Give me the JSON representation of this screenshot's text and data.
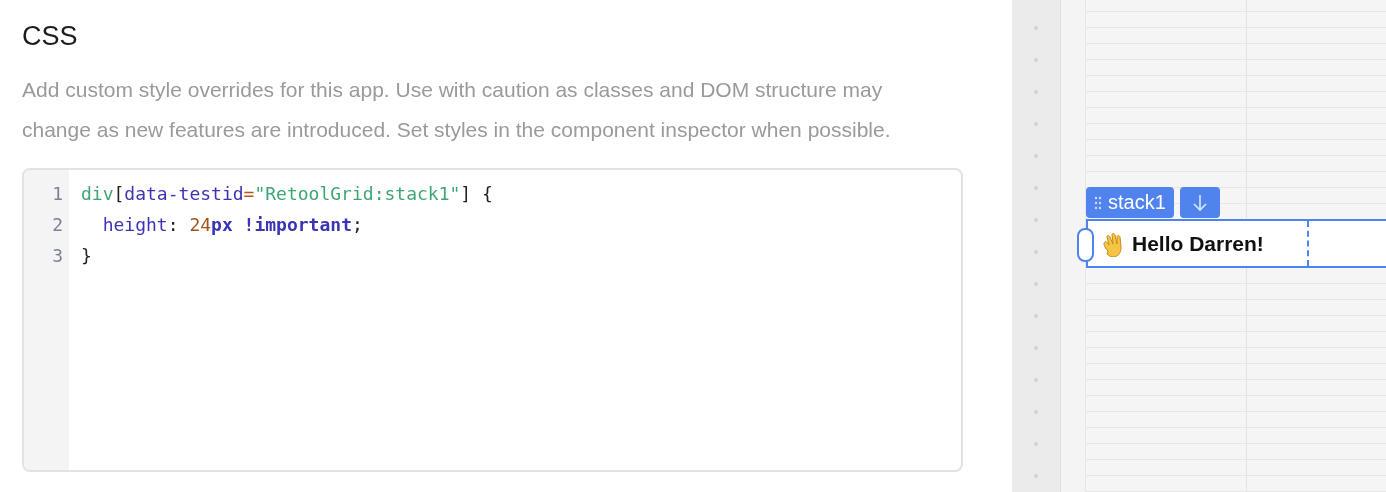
{
  "panel": {
    "title": "CSS",
    "description": "Add custom style overrides for this app. Use with caution as classes and DOM structure may change as new features are introduced. Set styles in the component inspector when possible."
  },
  "editor": {
    "lines": [
      {
        "number": "1",
        "tokens": [
          {
            "kind": "tag",
            "text": "div"
          },
          {
            "kind": "punct",
            "text": "["
          },
          {
            "kind": "attr",
            "text": "data-testid"
          },
          {
            "kind": "op",
            "text": "="
          },
          {
            "kind": "string",
            "text": "\"RetoolGrid:stack1\""
          },
          {
            "kind": "punct",
            "text": "] {"
          }
        ]
      },
      {
        "number": "2",
        "indent": true,
        "tokens": [
          {
            "kind": "prop",
            "text": "height"
          },
          {
            "kind": "punct",
            "text": ": "
          },
          {
            "kind": "number",
            "text": "24"
          },
          {
            "kind": "unit",
            "text": "px"
          },
          {
            "kind": "keyword",
            "text": "!important"
          },
          {
            "kind": "punct",
            "text": ";"
          }
        ]
      },
      {
        "number": "3",
        "tokens": [
          {
            "kind": "punct",
            "text": "}"
          }
        ]
      }
    ]
  },
  "canvas": {
    "component_tag": "stack1",
    "text": "Hello Darren!"
  }
}
